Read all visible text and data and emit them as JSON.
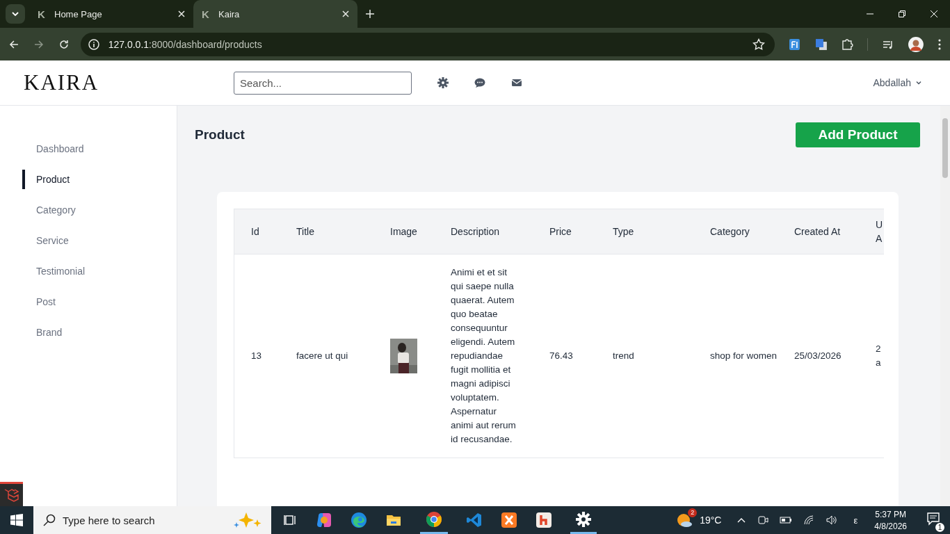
{
  "browser": {
    "tabs": [
      {
        "favicon": "K",
        "title": "Home Page",
        "selected": false
      },
      {
        "favicon": "K",
        "title": "Kaira",
        "selected": true
      }
    ],
    "url_host": "127.0.0.1",
    "url_path": ":8000/dashboard/products"
  },
  "header": {
    "logo": "KAIRA",
    "search": {
      "placeholder": "Search..."
    },
    "user": "Abdallah"
  },
  "sidebar": {
    "items": [
      {
        "label": "Dashboard",
        "selected": false
      },
      {
        "label": "Product",
        "selected": true
      },
      {
        "label": "Category",
        "selected": false
      },
      {
        "label": "Service",
        "selected": false
      },
      {
        "label": "Testimonial",
        "selected": false
      },
      {
        "label": "Post",
        "selected": false
      },
      {
        "label": "Brand",
        "selected": false
      }
    ]
  },
  "page": {
    "title": "Product",
    "add_button": "Add Product"
  },
  "table": {
    "columns": [
      "Id",
      "Title",
      "Image",
      "Description",
      "Price",
      "Type",
      "Category",
      "Created At",
      "U A"
    ],
    "rows": [
      {
        "id": "13",
        "title": "facere ut qui",
        "description": "Animi et et sit qui saepe nulla quaerat. Autem quo beatae consequuntur eligendi. Autem repudiandae fugit mollitia et magni adipisci voluptatem. Aspernatur animi aut rerum id recusandae.",
        "price": "76.43",
        "type": "trend",
        "category": "shop for women",
        "created_at": "25/03/2026",
        "column_9": "2 a"
      }
    ]
  },
  "taskbar": {
    "search_placeholder": "Type here to search",
    "temperature": "19°C",
    "weather_badge": "2",
    "language": "ε",
    "time": "5:37 PM",
    "date": "4/8/2026",
    "notifications": "1"
  }
}
